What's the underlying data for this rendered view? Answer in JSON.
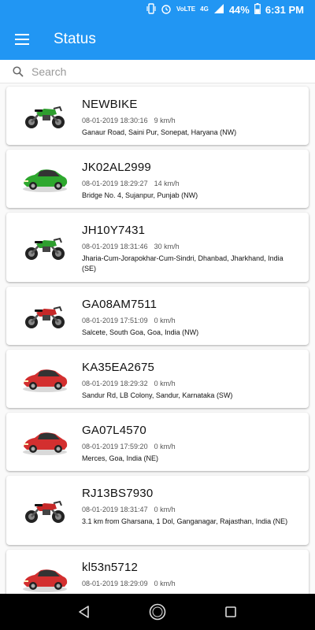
{
  "status_bar": {
    "battery": "44%",
    "time": "6:31 PM",
    "network": "4G"
  },
  "app_bar": {
    "title": "Status",
    "menu_icon": "hamburger-icon"
  },
  "search": {
    "placeholder": "Search",
    "value": ""
  },
  "vehicles": [
    {
      "name": "NEWBIKE",
      "timestamp": "08-01-2019 18:30:16",
      "speed": "9 km/h",
      "address": "Ganaur Road, Saini Pur, Sonepat, Haryana (NW)",
      "icon": "motorbike-icon",
      "color": "#2e9e2e"
    },
    {
      "name": "JK02AL2999",
      "timestamp": "08-01-2019 18:29:27",
      "speed": "14 km/h",
      "address": "Bridge No. 4, Sujanpur, Punjab (NW)",
      "icon": "car-icon",
      "color": "#2ea82e"
    },
    {
      "name": "JH10Y7431",
      "timestamp": "08-01-2019 18:31:46",
      "speed": "30 km/h",
      "address": "Jharia-Cum-Jorapokhar-Cum-Sindri, Dhanbad, Jharkhand, India (SE)",
      "icon": "motorbike-icon",
      "color": "#2e9e2e"
    },
    {
      "name": "GA08AM7511",
      "timestamp": "08-01-2019 17:51:09",
      "speed": "0 km/h",
      "address": "Salcete, South Goa, Goa, India (NW)",
      "icon": "motorbike-icon",
      "color": "#c62828"
    },
    {
      "name": "KA35EA2675",
      "timestamp": "08-01-2019 18:29:32",
      "speed": "0 km/h",
      "address": "Sandur Rd, LB Colony, Sandur, Karnataka (SW)",
      "icon": "car-icon",
      "color": "#d32f2f"
    },
    {
      "name": "GA07L4570",
      "timestamp": "08-01-2019 17:59:20",
      "speed": "0 km/h",
      "address": "Merces, Goa, India (NE)",
      "icon": "car-icon",
      "color": "#d32f2f"
    },
    {
      "name": "RJ13BS7930",
      "timestamp": "08-01-2019 18:31:47",
      "speed": "0 km/h",
      "address": "3.1 km from Gharsana, 1 Dol, Ganganagar, Rajasthan, India (NE)",
      "icon": "motorbike-icon",
      "color": "#c62828"
    },
    {
      "name": "kl53n5712",
      "timestamp": "08-01-2019 18:29:09",
      "speed": "0 km/h",
      "address": "",
      "icon": "car-icon",
      "color": "#d32f2f"
    }
  ],
  "nav_bar": {
    "back_icon": "back-triangle-icon",
    "home_icon": "home-circle-icon",
    "recents_icon": "recents-square-icon"
  }
}
